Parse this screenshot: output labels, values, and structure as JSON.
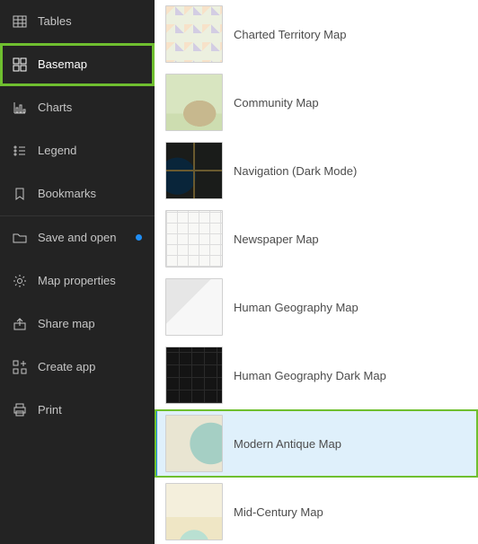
{
  "sidebar": {
    "items": [
      {
        "label": "Tables",
        "icon": "table-icon"
      },
      {
        "label": "Basemap",
        "icon": "basemap-icon",
        "selected": true
      },
      {
        "label": "Charts",
        "icon": "charts-icon"
      },
      {
        "label": "Legend",
        "icon": "legend-icon"
      },
      {
        "label": "Bookmarks",
        "icon": "bookmarks-icon"
      },
      {
        "label": "Save and open",
        "icon": "folder-icon",
        "unsaved": true
      },
      {
        "label": "Map properties",
        "icon": "gear-icon"
      },
      {
        "label": "Share map",
        "icon": "share-icon"
      },
      {
        "label": "Create app",
        "icon": "create-app-icon"
      },
      {
        "label": "Print",
        "icon": "print-icon"
      }
    ]
  },
  "basemaps": {
    "items": [
      {
        "label": "Charted Territory Map",
        "thumb": "thumb-charted"
      },
      {
        "label": "Community Map",
        "thumb": "thumb-community"
      },
      {
        "label": "Navigation (Dark Mode)",
        "thumb": "thumb-nav-dark"
      },
      {
        "label": "Newspaper Map",
        "thumb": "thumb-newspaper"
      },
      {
        "label": "Human Geography Map",
        "thumb": "thumb-human"
      },
      {
        "label": "Human Geography Dark Map",
        "thumb": "thumb-human-dark"
      },
      {
        "label": "Modern Antique Map",
        "thumb": "thumb-antique",
        "selected": true
      },
      {
        "label": "Mid-Century Map",
        "thumb": "thumb-midcentury"
      }
    ]
  },
  "colors": {
    "accent_green": "#6fbf2f",
    "accent_blue": "#1f8df4",
    "sidebar_bg": "#232323"
  }
}
